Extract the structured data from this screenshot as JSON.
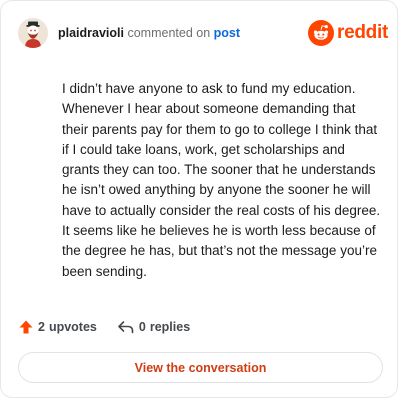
{
  "header": {
    "username": "plaidravioli",
    "action_text": "commented on",
    "target_link": "post",
    "brand_name": "reddit",
    "brand_color": "#ff4500"
  },
  "comment": {
    "text": "I didn’t have anyone to ask to fund my education. Whenever I hear about someone demanding that their parents pay for them to go to college I think that if I could take loans, work, get scholarships and grants they can too. The sooner that he understands he isn’t owed anything by anyone the sooner he will have to actually consider the real costs of his degree. It seems like he believes he is worth less because of the degree he has, but that’s not the message you’re been sending."
  },
  "footer": {
    "upvote_icon": "upvote-arrow-icon",
    "upvote_count": "2",
    "upvote_label": "upvotes",
    "reply_icon": "reply-arrow-icon",
    "reply_count": "0",
    "reply_label": "replies"
  },
  "cta": {
    "label": "View the conversation"
  }
}
